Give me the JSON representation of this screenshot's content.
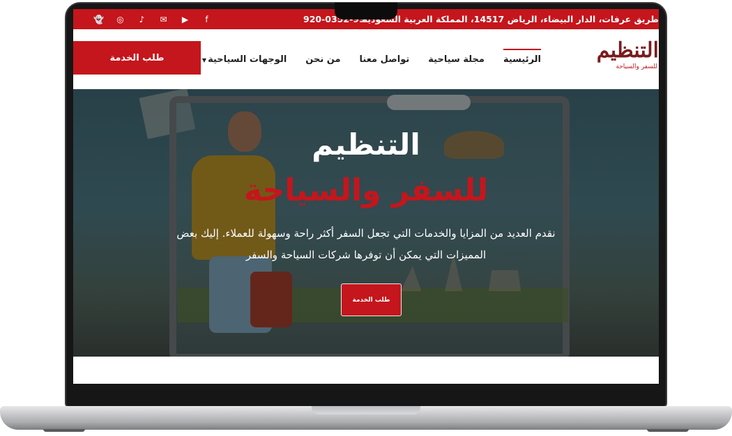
{
  "topbar": {
    "address": "طريق عرفات، الدار البيضاء، الرياض 14517، المملكة العربية السعودية",
    "phone": "920-0352-99",
    "socials": [
      {
        "icon": "snapchat-icon",
        "glyph": "👻"
      },
      {
        "icon": "instagram-icon",
        "glyph": "◎"
      },
      {
        "icon": "tiktok-icon",
        "glyph": "♪"
      },
      {
        "icon": "email-icon",
        "glyph": "✉"
      },
      {
        "icon": "youtube-icon",
        "glyph": "▶"
      },
      {
        "icon": "facebook-icon",
        "glyph": "f"
      }
    ]
  },
  "header": {
    "logo": {
      "main": "التنظيم",
      "sub": "للسفر والسياحة"
    },
    "nav": [
      {
        "label": "الرئيسية",
        "active": true
      },
      {
        "label": "مجلة سياحية",
        "active": false
      },
      {
        "label": "تواصل معنا",
        "active": false
      },
      {
        "label": "من نحن",
        "active": false
      },
      {
        "label": "الوجهات السياحية",
        "active": false,
        "dropdown": true
      }
    ],
    "cta_label": "طلب الخدمة"
  },
  "hero": {
    "title": "التنظيم",
    "subtitle": "للسفر والسياحة",
    "description": "نقدم العديد من المزايا والخدمات التي تجعل السفر أكثر راحة وسهولة للعملاء. إليك بعض المميزات التي يمكن أن توفرها شركات السياحة والسفر",
    "button_label": "طلب الخدمة"
  },
  "colors": {
    "brand_red": "#c4161c",
    "logo_maroon": "#7a1b1d"
  }
}
